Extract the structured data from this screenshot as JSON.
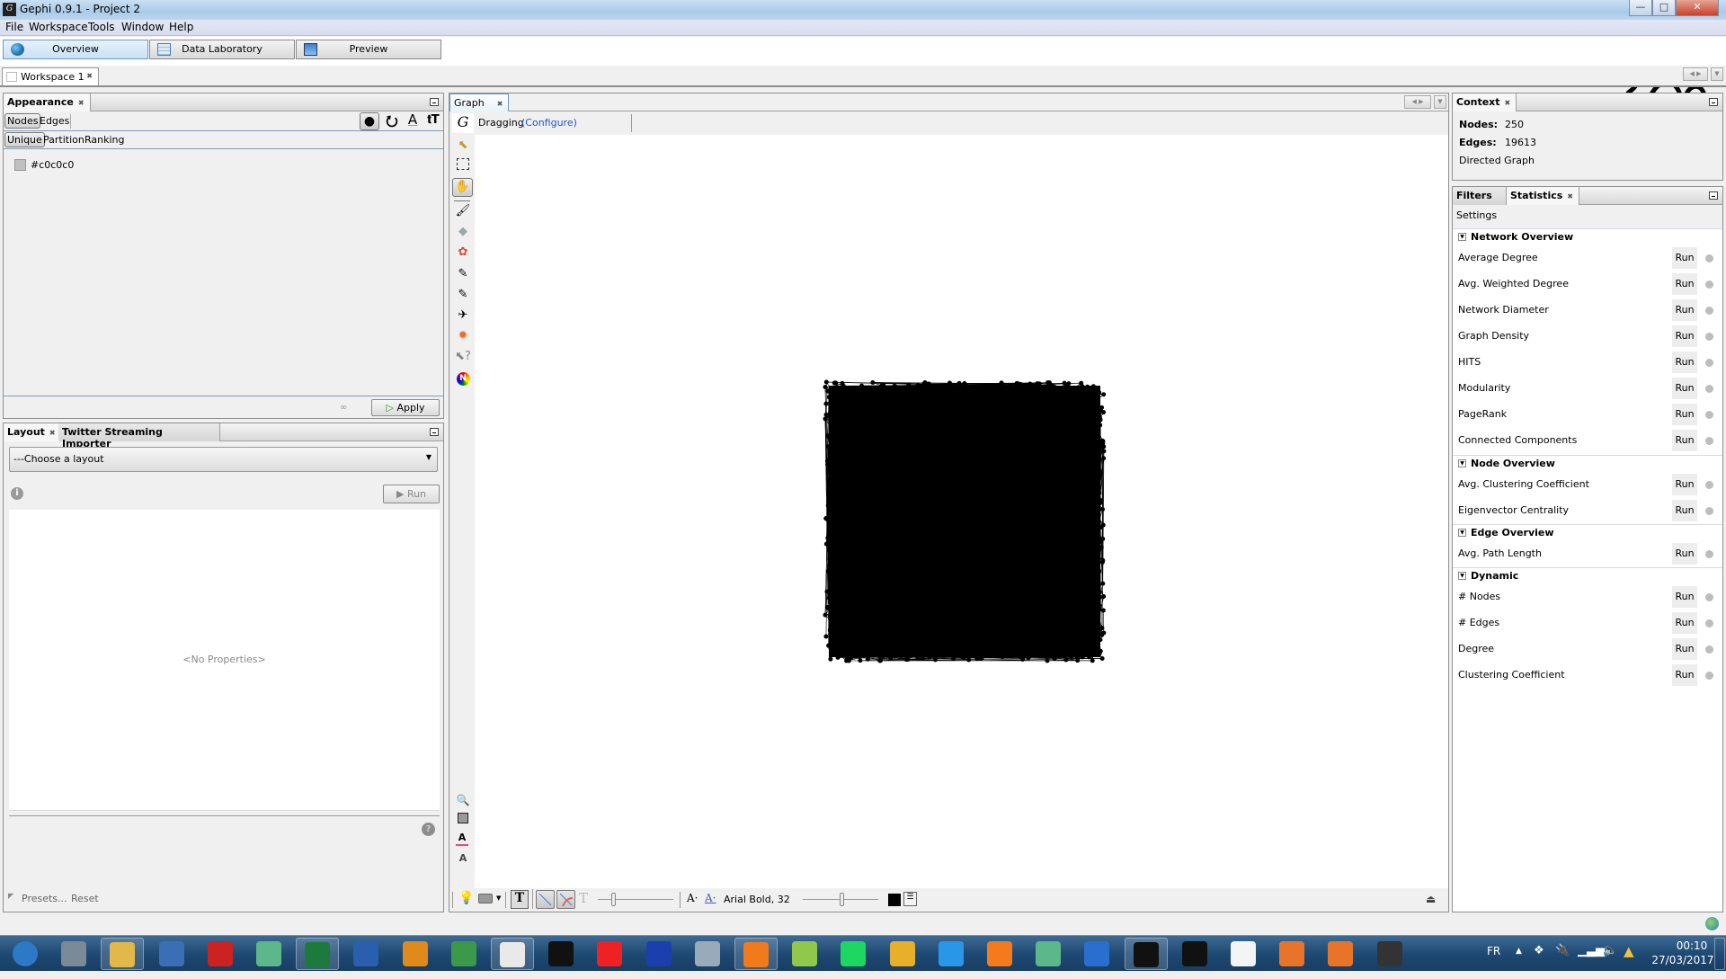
{
  "window": {
    "title": "Gephi 0.9.1 - Project 2",
    "controls": {
      "minimize": "—",
      "restore": "□",
      "close": "✕"
    }
  },
  "menu": [
    "File",
    "Workspace",
    "Tools",
    "Window",
    "Help"
  ],
  "perspectives": [
    {
      "label": "Overview",
      "icon": "globe-icon",
      "active": true
    },
    {
      "label": "Data Laboratory",
      "icon": "table-icon",
      "active": false
    },
    {
      "label": "Preview",
      "icon": "monitor-icon",
      "active": false
    }
  ],
  "workspace_tab": {
    "label": "Workspace 1"
  },
  "appearance": {
    "title": "Appearance",
    "targets": [
      "Nodes",
      "Edges"
    ],
    "selected_target": "Nodes",
    "modes": [
      "Unique",
      "Partition",
      "Ranking"
    ],
    "selected_mode": "Unique",
    "transformers": [
      "color-palette-icon",
      "size-icon",
      "label-color-icon",
      "label-size-icon"
    ],
    "color_value": "#c0c0c0",
    "apply_label": "Apply"
  },
  "layout": {
    "tabs": [
      "Layout",
      "Twitter Streaming Importer"
    ],
    "dropdown_value": "---Choose a layout",
    "run_label": "Run",
    "no_properties": "<No Properties>",
    "presets_label": "Presets...",
    "reset_label": "Reset"
  },
  "graph": {
    "tab": "Graph",
    "mode": "Dragging",
    "configure_link": "(Configure)",
    "tools": [
      "select-arrow-icon",
      "rectangle-select-icon",
      "drag-hand-icon",
      "painter-icon",
      "diamond-icon",
      "color-wheel-icon",
      "pencil-icon",
      "edge-pencil-icon",
      "shortest-path-icon",
      "heatmap-icon",
      "edit-cursor-icon",
      "neighbors-icon"
    ],
    "bottom_tools": [
      "zoom-fit-icon",
      "background-color-icon",
      "label-color-icon",
      "label-size-icon"
    ],
    "font_label": "Arial Bold, 32",
    "node_color": "#000000",
    "background": "#ffffff"
  },
  "context": {
    "title": "Context",
    "nodes_label": "Nodes:",
    "nodes_value": "250",
    "edges_label": "Edges:",
    "edges_value": "19613",
    "graph_type": "Directed Graph"
  },
  "statistics": {
    "tabs": [
      "Filters",
      "Statistics"
    ],
    "settings_label": "Settings",
    "run_label": "Run",
    "groups": [
      {
        "title": "Network Overview",
        "items": [
          "Average Degree",
          "Avg. Weighted Degree",
          "Network Diameter",
          "Graph Density",
          "HITS",
          "Modularity",
          "PageRank",
          "Connected Components"
        ]
      },
      {
        "title": "Node Overview",
        "items": [
          "Avg. Clustering Coefficient",
          "Eigenvector Centrality"
        ]
      },
      {
        "title": "Edge Overview",
        "items": [
          "Avg. Path Length"
        ]
      },
      {
        "title": "Dynamic",
        "items": [
          "# Nodes",
          "# Edges",
          "Degree",
          "Clustering Coefficient"
        ]
      }
    ]
  },
  "taskbar": {
    "apps": [
      "Start",
      "Lock",
      "Explorer",
      "PuTTY",
      "Media",
      "Atom",
      "Excel",
      "Word",
      "Outlook",
      "Rocket",
      "Chrome",
      "Gephi",
      "Red app",
      "Tool",
      "Box",
      "Player",
      "Notepad++",
      "Spotify",
      "Slack",
      "Messenger",
      "VLC",
      "Atom",
      "Heat",
      "Gephi",
      "Cmd",
      "IPython",
      "Sync",
      "Firefox",
      "Console"
    ],
    "language": "FR",
    "time": "00:10",
    "date": "27/03/2017"
  }
}
